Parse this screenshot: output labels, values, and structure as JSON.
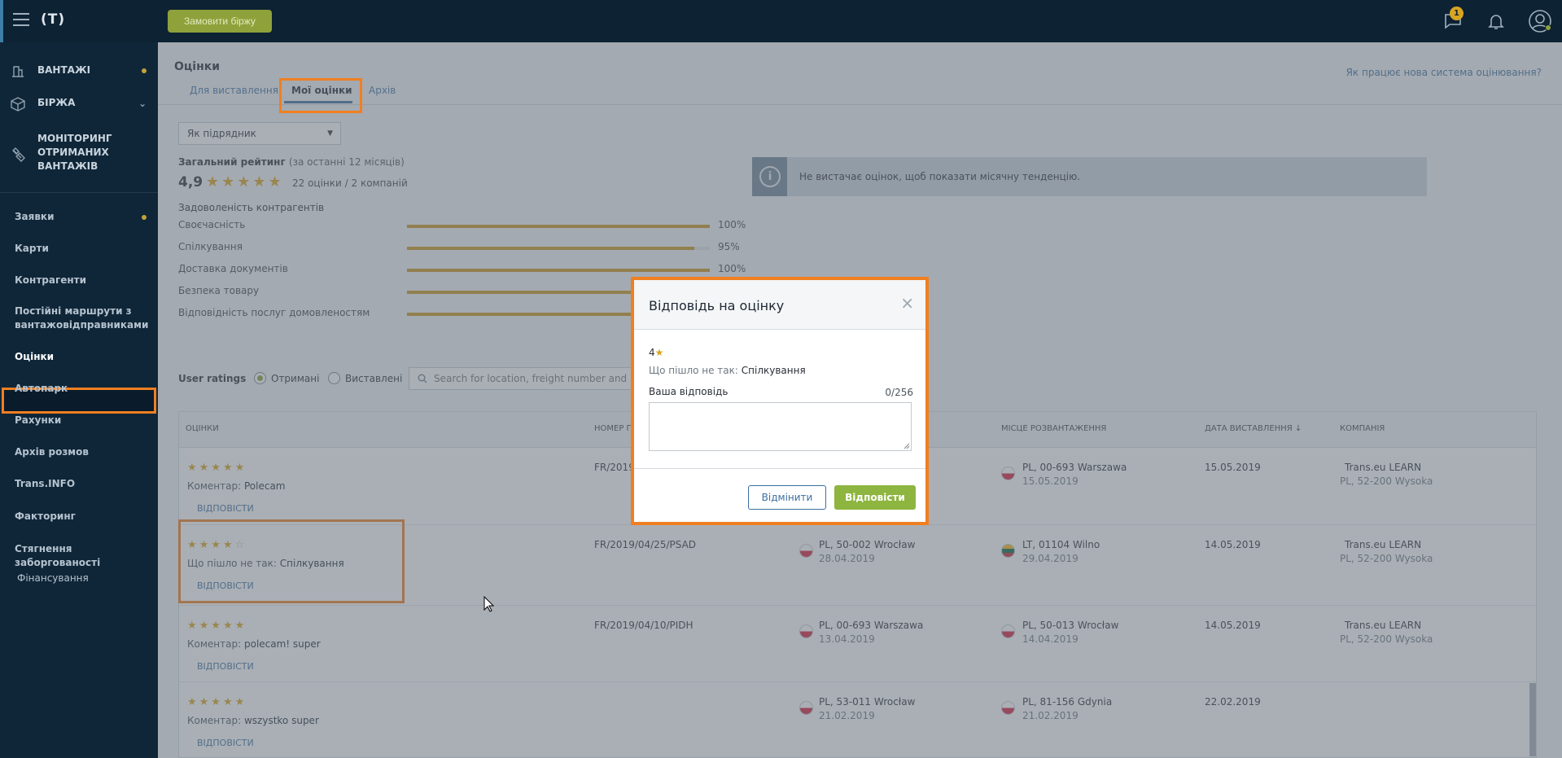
{
  "topbar": {
    "logo": "(T)",
    "order_button": "Замовити біржу",
    "notification_count": "1"
  },
  "sidebar": {
    "top_items": [
      {
        "label": "ВАНТАЖІ",
        "icon": "cargo-icon"
      },
      {
        "label": "БІРЖА",
        "icon": "exchange-icon"
      },
      {
        "label": "МОНІТОРИНГ\nОТРИМАНИХ\nВАНТАЖІВ",
        "icon": "satellite-icon"
      }
    ],
    "items": [
      "Заявки",
      "Карти",
      "Контрагенти",
      "Постійні маршрути з\nвантажовідправниками",
      "Оцінки",
      "Автопарк",
      "Рахунки",
      "Архів розмов",
      "Trans.INFO",
      "Факторинг",
      "Стягнення заборгованості",
      "Фінансування"
    ]
  },
  "page": {
    "title": "Оцінки",
    "help_link": "Як працює нова система оцінювання?",
    "tabs": [
      "Для виставлення",
      "Мої оцінки",
      "Архів"
    ]
  },
  "role_select": "Як підрядник",
  "overall": {
    "title": "Загальний рейтинг",
    "subtitle": "(за останні 12 місяців)",
    "score": "4,9",
    "stars": "★★★★★",
    "count": "22 оцінки / 2 компаній",
    "satisfaction_label": "Задоволеність контрагентів"
  },
  "metrics": [
    {
      "label": "Своєчасність",
      "value": "100%",
      "fraction": 1.0
    },
    {
      "label": "Спілкування",
      "value": "95%",
      "fraction": 0.95
    },
    {
      "label": "Доставка документів",
      "value": "100%",
      "fraction": 1.0
    },
    {
      "label": "Безпека товару",
      "value": "",
      "fraction": 1.0
    },
    {
      "label": "Відповідність послуг домовленостям",
      "value": "",
      "fraction": 1.0
    }
  ],
  "info_message": "Не вистачає оцінок, щоб показати місячну тенденцію.",
  "user_ratings": {
    "title": "User ratings",
    "radio_received": "Отримані",
    "radio_given": "Виставлені",
    "search_placeholder": "Search for location, freight number and com..."
  },
  "table": {
    "headers": [
      "Оцінки",
      "Номер пр",
      "",
      "Місце розвантаження",
      "Дата виставлення ↓",
      "Компанія"
    ],
    "reply_label": "Відповісти",
    "rows": [
      {
        "stars": "★★★★★",
        "empty": "",
        "comment_label": "Коментар:",
        "comment": "Polecam",
        "number": "FR/2019",
        "load_place": "",
        "load_date": "",
        "load_flag": "",
        "unload_place": "PL, 00-693 Warszawa",
        "unload_date": "15.05.2019",
        "unload_flag": "pl",
        "date": "15.05.2019",
        "company": "Trans.eu LEARN",
        "company_addr": "PL, 52-200 Wysoka"
      },
      {
        "stars": "★★★★",
        "empty": "☆",
        "comment_label": "Що пішло не так:",
        "comment": "Спілкування",
        "number": "FR/2019/04/25/PSAD",
        "load_place": "PL, 50-002 Wrocław",
        "load_date": "28.04.2019",
        "load_flag": "pl",
        "unload_place": "LT, 01104 Wilno",
        "unload_date": "29.04.2019",
        "unload_flag": "lt",
        "date": "14.05.2019",
        "company": "Trans.eu LEARN",
        "company_addr": "PL, 52-200 Wysoka"
      },
      {
        "stars": "★★★★★",
        "empty": "",
        "comment_label": "Коментар:",
        "comment": "polecam! super",
        "number": "FR/2019/04/10/PIDH",
        "load_place": "PL, 00-693 Warszawa",
        "load_date": "13.04.2019",
        "load_flag": "pl",
        "unload_place": "PL, 50-013 Wrocław",
        "unload_date": "14.04.2019",
        "unload_flag": "pl",
        "date": "14.05.2019",
        "company": "Trans.eu LEARN",
        "company_addr": "PL, 52-200 Wysoka"
      },
      {
        "stars": "★★★★★",
        "empty": "",
        "comment_label": "Коментар:",
        "comment": "wszystko super",
        "number": "",
        "load_place": "PL, 53-011 Wrocław",
        "load_date": "21.02.2019",
        "load_flag": "pl",
        "unload_place": "PL, 81-156 Gdynia",
        "unload_date": "21.02.2019",
        "unload_flag": "pl",
        "date": "22.02.2019",
        "company": "",
        "company_addr": ""
      }
    ]
  },
  "modal": {
    "title": "Відповідь на оцінку",
    "rating": "4",
    "rating_star": "★",
    "wrong_label": "Що пішло не так:",
    "wrong_value": "Спілкування",
    "answer_label": "Ваша відповідь",
    "char_count": "0/256",
    "cancel": "Відмінити",
    "reply": "Відповісти"
  },
  "colors": {
    "highlight": "#f07f21",
    "star": "#d9a520",
    "primary_green": "#8db53f",
    "sidebar": "#0f2638"
  }
}
